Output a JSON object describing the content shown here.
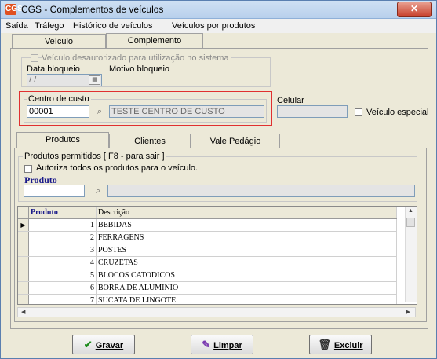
{
  "window": {
    "title": "CGS - Complementos de veículos",
    "close_label": "✕",
    "app_icon": "CGS"
  },
  "menu": [
    {
      "label": "Saída"
    },
    {
      "label": "Tráfego"
    },
    {
      "label": "Histórico de veículos"
    },
    {
      "label": "Veículos por produtos"
    }
  ],
  "tabs": {
    "veiculo": "Veículo",
    "complemento": "Complemento"
  },
  "complemento": {
    "chk_desautorizado": "Veículo desautorizado para utilização no sistema",
    "data_bloqueio_label": "Data bloqueio",
    "data_bloqueio_value": " / /",
    "motivo_label": "Motivo bloqueio",
    "centro_label": "Centro de custo",
    "centro_code": "00001",
    "centro_desc": "TESTE CENTRO DE CUSTO",
    "celular_label": "Celular",
    "veiculo_especial": "Veículo especial"
  },
  "subtabs": {
    "produtos": "Produtos",
    "clientes": "Clientes",
    "vale": "Vale Pedágio"
  },
  "produtos": {
    "group_label": "Produtos permitidos [ F8 - para sair ]",
    "autoriza": "Autoriza todos os produtos para o veículo.",
    "produto_label": "Produto",
    "columns": [
      "Produto",
      "Descrição"
    ],
    "rows": [
      {
        "id": "1",
        "desc": "BEBIDAS"
      },
      {
        "id": "2",
        "desc": "FERRAGENS"
      },
      {
        "id": "3",
        "desc": "POSTES"
      },
      {
        "id": "4",
        "desc": "CRUZETAS"
      },
      {
        "id": "5",
        "desc": "BLOCOS CATODICOS"
      },
      {
        "id": "6",
        "desc": "BORRA DE ALUMINIO"
      },
      {
        "id": "7",
        "desc": "SUCATA DE LINGOTE"
      }
    ]
  },
  "buttons": {
    "gravar": "Gravar",
    "limpar": "Limpar",
    "excluir": "Excluir"
  }
}
